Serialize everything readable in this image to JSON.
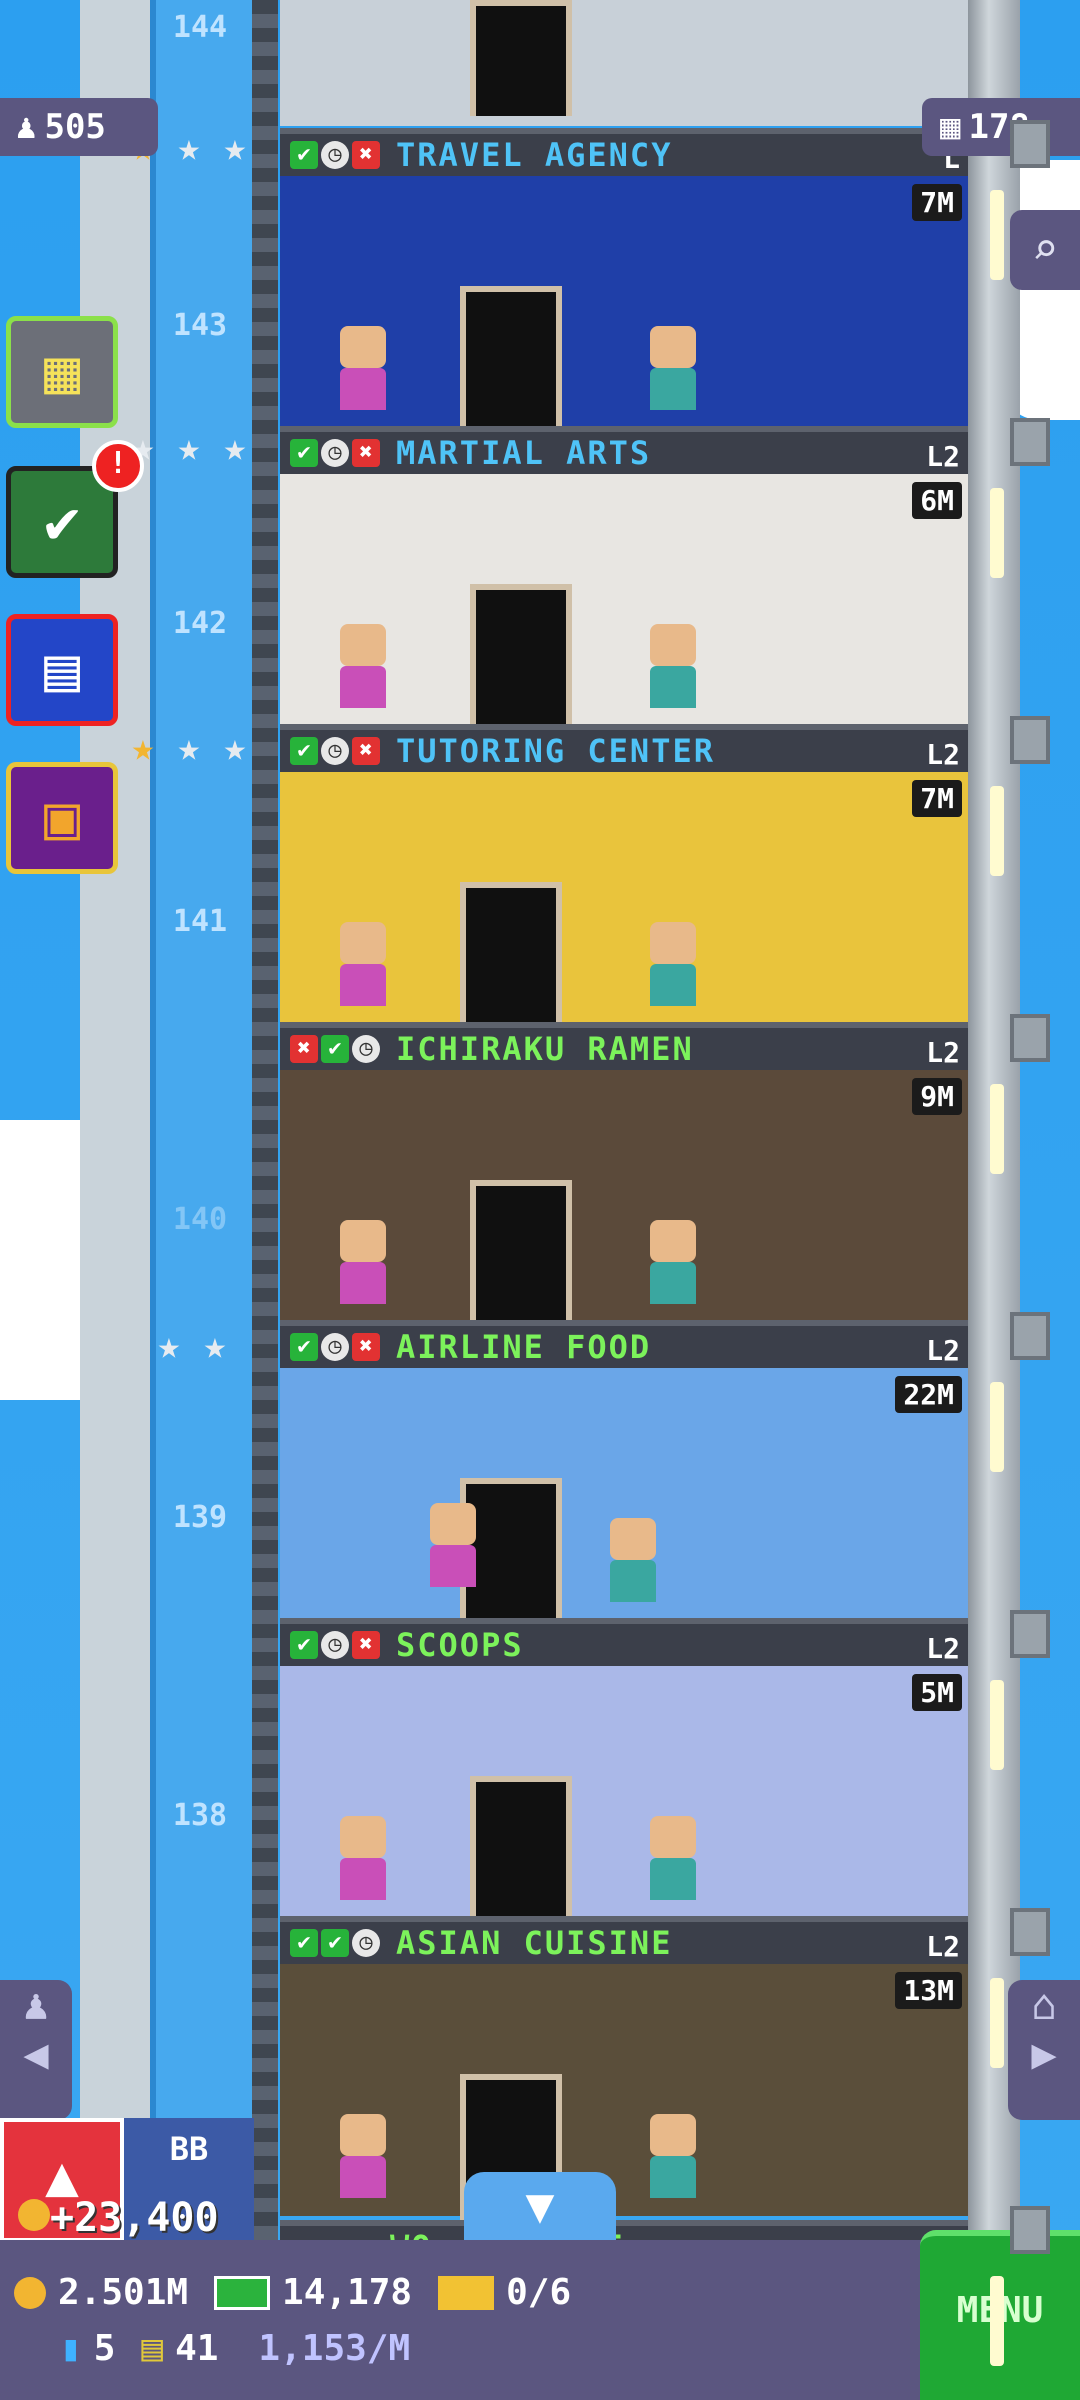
{
  "top_left_counter": {
    "icon": "person-icon",
    "value": "505"
  },
  "top_right_counter": {
    "icon": "building-icon",
    "value": "178"
  },
  "floor_numbers": [
    "144",
    "143",
    "142",
    "141",
    "140",
    "139",
    "138"
  ],
  "floors": [
    {
      "name": "TRAVEL AGENCY",
      "level": "L",
      "earning": "7M",
      "name_color": "#4fc3f7",
      "status": [
        "ok",
        "clk",
        "no"
      ],
      "room_color": "#1f3fa8"
    },
    {
      "name": "MARTIAL ARTS",
      "level": "L2",
      "earning": "6M",
      "name_color": "#4fc3f7",
      "status": [
        "ok",
        "clk",
        "no"
      ],
      "room_color": "#e8e6e2"
    },
    {
      "name": "TUTORING CENTER",
      "level": "L2",
      "earning": "7M",
      "name_color": "#4fc3f7",
      "status": [
        "ok",
        "clk",
        "no"
      ],
      "room_color": "#e9c43c"
    },
    {
      "name": "ICHIRAKU RAMEN",
      "level": "L2",
      "earning": "9M",
      "name_color": "#7cf25b",
      "status": [
        "no",
        "ok",
        "clk"
      ],
      "room_color": "#5b4a3a"
    },
    {
      "name": "AIRLINE FOOD",
      "level": "L2",
      "earning": "22M",
      "name_color": "#7cf25b",
      "status": [
        "ok",
        "clk",
        "no"
      ],
      "room_color": "#6aa6e8"
    },
    {
      "name": "SCOOPS",
      "level": "L2",
      "earning": "5M",
      "name_color": "#7cf25b",
      "status": [
        "ok",
        "clk",
        "no"
      ],
      "room_color": "#aab8e8"
    },
    {
      "name": "ASIAN CUISINE",
      "level": "L2",
      "earning": "13M",
      "name_color": "#7cf25b",
      "status": [
        "ok",
        "ok",
        "clk"
      ],
      "room_color": "#5a4e3a"
    }
  ],
  "bottom_partial_floor": {
    "name": "WO... UFFET",
    "level": "L"
  },
  "side_buttons": [
    "building-icon",
    "checklist-icon",
    "calendar-icon",
    "gift-icon"
  ],
  "notification_badge": "!",
  "bb_button": {
    "label": "BB",
    "coin_popup": "+23,400"
  },
  "status_bar": {
    "coins": "2.501M",
    "bux": "14,178",
    "tickets": "0/6",
    "elevator_count": "5",
    "vip_count": "41",
    "rate": "1,153/M"
  },
  "menu_label": "MENU",
  "colors": {
    "accent_green": "#1fa834",
    "panel": "#5b5680",
    "sky": "#2c9ff0"
  }
}
